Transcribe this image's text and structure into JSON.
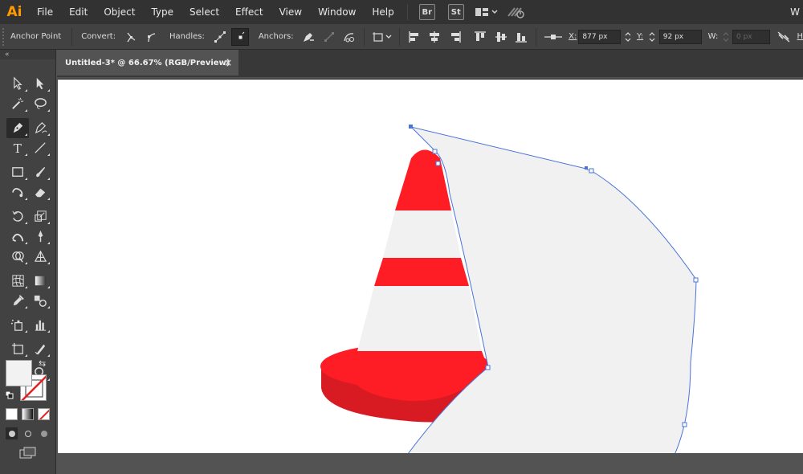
{
  "app": {
    "logo": "Ai",
    "right_cut": "W"
  },
  "menu": [
    "File",
    "Edit",
    "Object",
    "Type",
    "Select",
    "Effect",
    "View",
    "Window",
    "Help"
  ],
  "bridge_badges": [
    "Br",
    "St"
  ],
  "control": {
    "mode": "Anchor Point",
    "convert": "Convert:",
    "handles": "Handles:",
    "anchors": "Anchors:",
    "x_label": "X:",
    "x_value": "877 px",
    "y_label": "Y:",
    "y_value": "92 px",
    "w_label": "W:",
    "w_value": "0 px"
  },
  "document": {
    "tab_title": "Untitled-3* @ 66.67% (RGB/Preview)",
    "close_glyph": "×"
  },
  "tools": [
    [
      "selection-tool-icon",
      "direct-selection-tool-icon"
    ],
    [
      "magic-wand-tool-icon",
      "lasso-tool-icon"
    ],
    [
      "pen-tool-icon",
      "curvature-tool-icon"
    ],
    [
      "type-tool-icon",
      "line-segment-tool-icon"
    ],
    [
      "rectangle-tool-icon",
      "paintbrush-tool-icon"
    ],
    [
      "shaper-tool-icon",
      "eraser-tool-icon"
    ],
    [
      "rotate-tool-icon",
      "scale-tool-icon"
    ],
    [
      "warp-tool-icon",
      "puppet-warp-tool-icon"
    ],
    [
      "shape-builder-tool-icon",
      "perspective-grid-tool-icon"
    ],
    [
      "mesh-tool-icon",
      "gradient-tool-icon"
    ],
    [
      "eyedropper-tool-icon",
      "blend-tool-icon"
    ],
    [
      "symbol-sprayer-tool-icon",
      "column-graph-tool-icon"
    ],
    [
      "artboard-tool-icon",
      "slice-tool-icon"
    ],
    [
      "hand-tool-icon",
      "zoom-tool-icon"
    ]
  ],
  "type_glyph": "T",
  "colors": {
    "cone_red": "#ff1d25",
    "cone_red_dark": "#d81b22",
    "cone_white": "#f1f1f2",
    "path_blue": "#4a74d8",
    "fill_swatch": "#f2f2f2"
  }
}
